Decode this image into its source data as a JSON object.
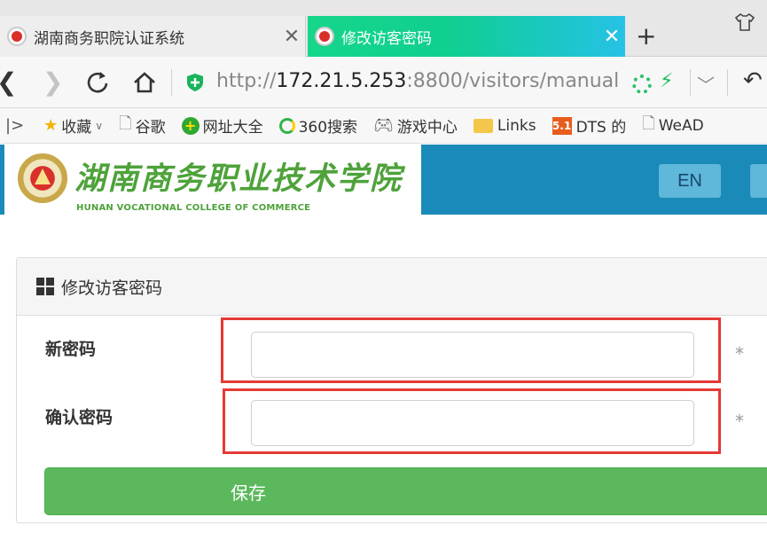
{
  "browser": {
    "tabs": [
      {
        "title": "湖南商务职院认证系统",
        "active": false
      },
      {
        "title": "修改访客密码",
        "active": true
      }
    ],
    "new_tab_label": "+",
    "url": {
      "scheme": "http://",
      "host": "172.21.5.253",
      "rest": ":8800/visitors/manual"
    },
    "bookmarks": [
      {
        "label": "收藏",
        "icon": "star-icon"
      },
      {
        "label": "谷歌",
        "icon": "document-icon"
      },
      {
        "label": "网址大全",
        "icon": "plus-circle-icon"
      },
      {
        "label": "360搜索",
        "icon": "search-ring-icon"
      },
      {
        "label": "游戏中心",
        "icon": "gamepad-icon"
      },
      {
        "label": "Links",
        "icon": "folder-icon"
      },
      {
        "label": "DTS 的",
        "icon": "badge-51-icon"
      },
      {
        "label": "WeAD",
        "icon": "document-icon"
      }
    ]
  },
  "site": {
    "name_cn": "湖南商务职业技术学院",
    "name_en": "HUNAN VOCATIONAL COLLEGE OF COMMERCE",
    "lang_button": "EN"
  },
  "form": {
    "panel_title": "修改访客密码",
    "new_password_label": "新密码",
    "new_password_value": "",
    "confirm_password_label": "确认密码",
    "confirm_password_value": "",
    "required_mark": "*",
    "save_label": "保存"
  },
  "colors": {
    "active_tab_gradient_start": "#15d68a",
    "header_blue": "#1a8ab8",
    "college_green": "#4ea23a",
    "save_green": "#5cb85c",
    "highlight_red": "#e53935"
  }
}
